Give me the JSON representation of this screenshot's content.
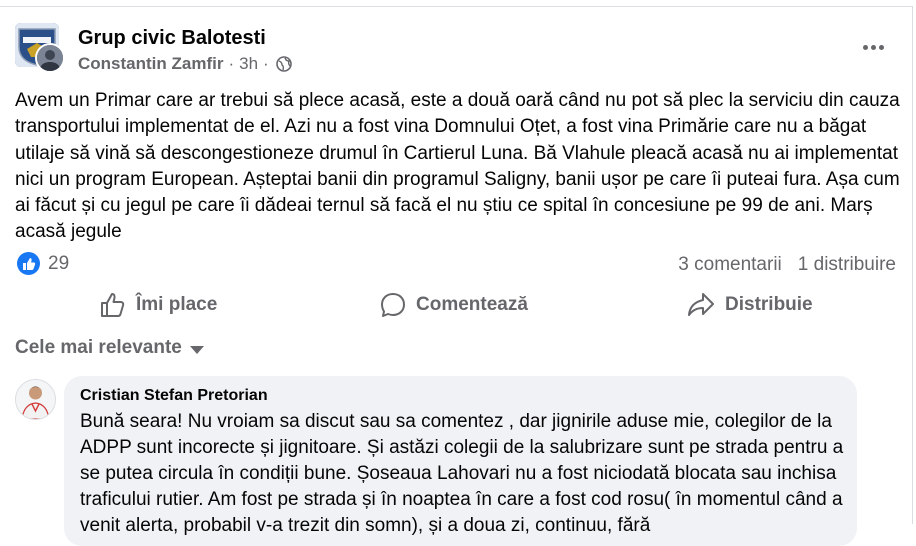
{
  "post": {
    "group_name": "Grup civic Balotesti",
    "author": "Constantin Zamfir",
    "separator": "·",
    "time": "3h",
    "privacy_icon": "globe-icon",
    "more_icon": "more-options-icon",
    "text": "Avem un Primar care ar trebui să plece acasă, este a două oară când nu pot să plec la serviciu din cauza transportului implementat de el. Azi nu a fost vina Domnului Oțet, a fost vina Primărie care nu a băgat utilaje să vină să descongestioneze drumul în Cartierul Luna. Bă Vlahule pleacă acasă nu ai implementat nici un program European. Așteptai banii din programul Saligny, banii ușor pe care îi puteai fura. Așa cum ai făcut și cu jegul pe care îi dădeai ternul să  facă el nu știu ce spital în concesiune pe 99 de ani. Marș acasă jegule",
    "reaction_count": "29",
    "comments_count": "3 comentarii",
    "shares_count": "1 distribuire"
  },
  "actions": {
    "like": "Îmi place",
    "comment": "Comentează",
    "share": "Distribuie"
  },
  "comments_section": {
    "sort_label": "Cele mai relevante"
  },
  "comment": {
    "author": "Cristian Stefan Pretorian",
    "text": "Bună seara! Nu vroiam sa discut sau sa comentez , dar jignirile aduse mie, colegilor de la ADPP sunt incorecte și jignitoare. Și astăzi colegii de la salubrizare sunt pe strada pentru a se putea circula în condiții bune. Șoseaua Lahovari nu a fost niciodată blocata sau inchisa traficului rutier. Am fost pe strada și în noaptea în care a fost cod rosu( în momentul când a venit alerta, probabil v-a trezit din somn), și a doua zi, continuu, fără"
  },
  "colors": {
    "brand_blue": "#1877f2",
    "secondary_text": "#65676b",
    "bubble_bg": "#f0f2f5"
  }
}
